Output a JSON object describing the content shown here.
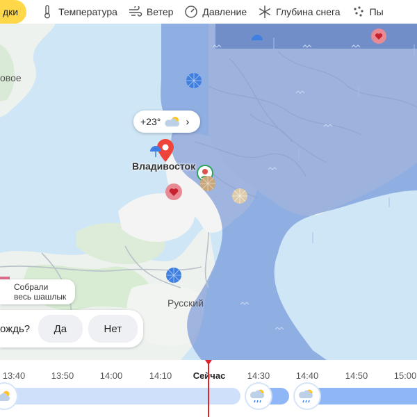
{
  "tabs": [
    {
      "label": "дки",
      "icon": "precipitation-icon",
      "active": true
    },
    {
      "label": "Температура",
      "icon": "thermometer-icon"
    },
    {
      "label": "Ветер",
      "icon": "wind-icon"
    },
    {
      "label": "Давление",
      "icon": "pressure-gauge-icon"
    },
    {
      "label": "Глубина снега",
      "icon": "snowflake-icon"
    },
    {
      "label": "Пы",
      "icon": "dust-icon"
    }
  ],
  "map": {
    "places": {
      "left_place": "овое",
      "city": "Владивосток",
      "island": "Русский"
    },
    "weather_pill": {
      "temperature": "+23°",
      "icon": "partly-cloudy-icon"
    },
    "comment": {
      "line1": "Собрали",
      "line2": "весь шашлык"
    },
    "poll": {
      "question": "ождь?",
      "yes": "Да",
      "no": "Нет"
    }
  },
  "timeline": {
    "times": [
      "13:40",
      "13:50",
      "14:00",
      "14:10",
      "Сейчас",
      "14:30",
      "14:40",
      "14:50",
      "15:00"
    ],
    "now_label": "Сейчас"
  },
  "colors": {
    "accent_tab": "#ffd84a",
    "rain_overlay": "#5b7fcf",
    "now_line": "#e0202a",
    "track_past": "#cfe0fb",
    "track_future": "#8fb6f6"
  }
}
